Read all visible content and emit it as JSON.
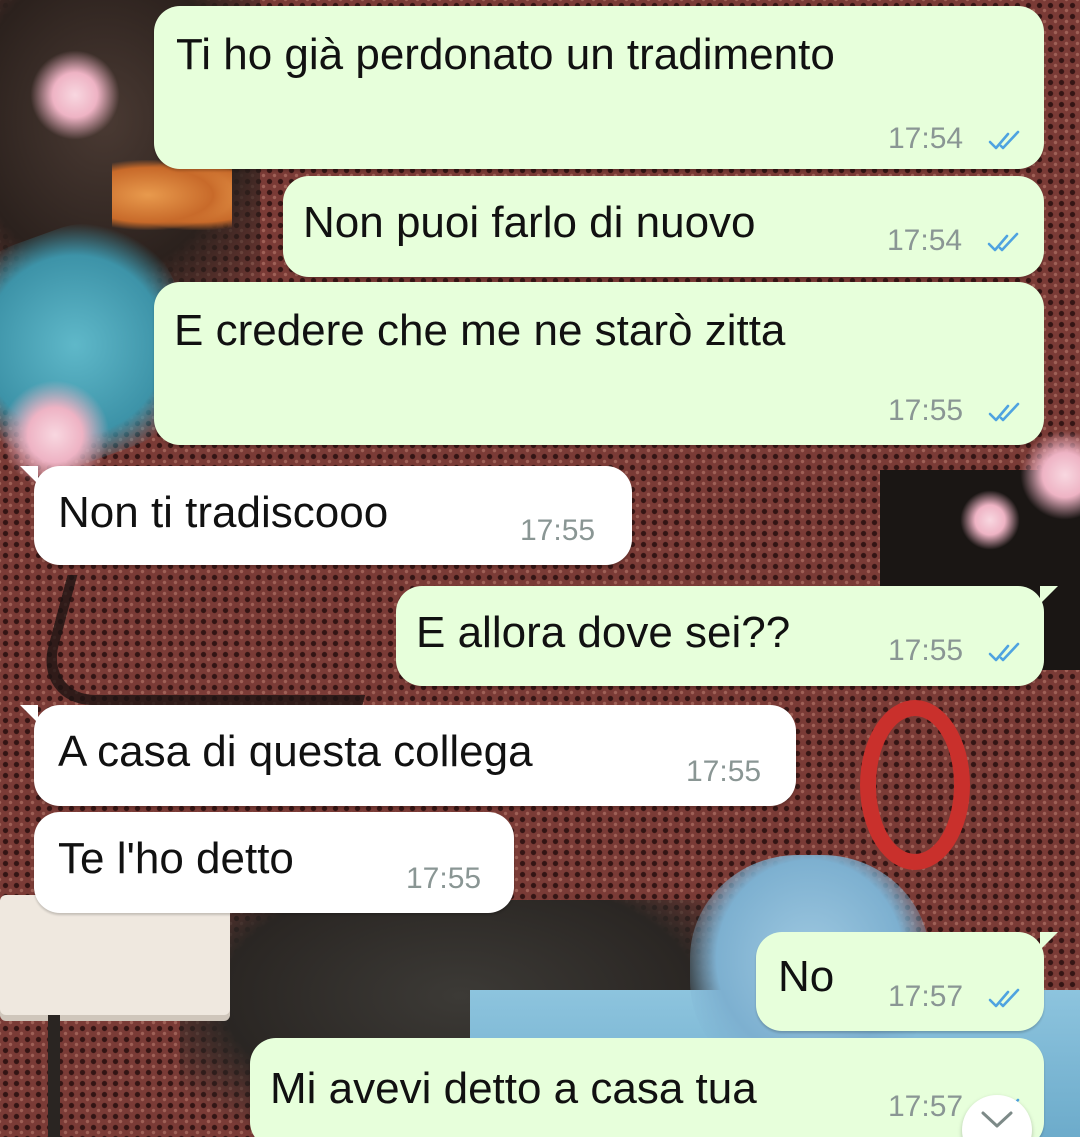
{
  "conversation": {
    "messages": [
      {
        "direction": "outgoing",
        "text": "Ti ho già perdonato un tradimento",
        "time": "17:54",
        "status": "read"
      },
      {
        "direction": "outgoing",
        "text": "Non puoi farlo di nuovo",
        "time": "17:54",
        "status": "read"
      },
      {
        "direction": "outgoing",
        "text": "E credere che me ne starò zitta",
        "time": "17:55",
        "status": "read"
      },
      {
        "direction": "incoming",
        "text": "Non ti tradiscooo",
        "time": "17:55"
      },
      {
        "direction": "outgoing",
        "text": "E allora dove sei??",
        "time": "17:55",
        "status": "read"
      },
      {
        "direction": "incoming",
        "text": "A casa di questa collega",
        "time": "17:55"
      },
      {
        "direction": "incoming",
        "text": "Te l'ho detto",
        "time": "17:55"
      },
      {
        "direction": "outgoing",
        "text": "No",
        "time": "17:57",
        "status": "read"
      },
      {
        "direction": "outgoing",
        "text": "Mi avevi detto a casa tua",
        "time": "17:57",
        "status": "read"
      }
    ]
  },
  "icons": {
    "read_receipt": "double-check-icon",
    "scroll_down": "chevron-down-icon"
  },
  "colors": {
    "outgoing_bubble": "#e7ffdb",
    "incoming_bubble": "#ffffff",
    "timestamp": "#8a9694",
    "read_tick": "#4fa3e0",
    "text": "#111111"
  }
}
